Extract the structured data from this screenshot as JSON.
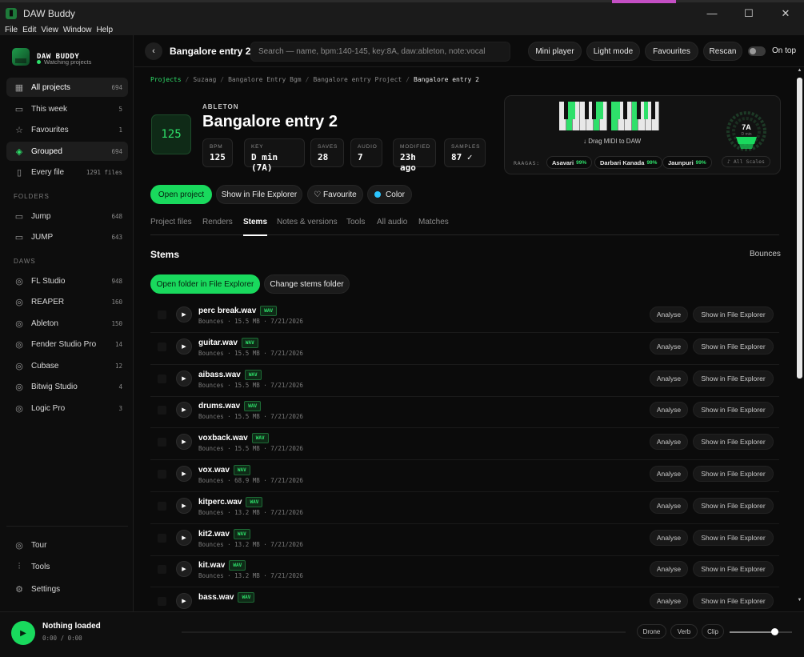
{
  "window": {
    "title": "DAW Buddy",
    "minimize": "—",
    "maximize": "☐",
    "close": "✕"
  },
  "menu": [
    "File",
    "Edit",
    "View",
    "Window",
    "Help"
  ],
  "brand": {
    "name": "DAW BUDDY",
    "status": "Watching projects"
  },
  "sidebar": {
    "nav": [
      {
        "label": "All projects",
        "count": "694",
        "icon": "grid-icon",
        "active": true
      },
      {
        "label": "This week",
        "count": "5",
        "icon": "calendar-icon",
        "active": false
      },
      {
        "label": "Favourites",
        "count": "1",
        "icon": "star-icon",
        "active": false
      },
      {
        "label": "Grouped",
        "count": "694",
        "icon": "layers-icon",
        "active": true
      },
      {
        "label": "Every file",
        "count": "1291 files",
        "icon": "file-icon",
        "active": false
      }
    ],
    "folders_label": "FOLDERS",
    "folders": [
      {
        "label": "Jump",
        "count": "648",
        "icon": "folder-icon"
      },
      {
        "label": "JUMP",
        "count": "643",
        "icon": "folder-icon"
      }
    ],
    "daws_label": "DAWS",
    "daws": [
      {
        "label": "FL Studio",
        "count": "948"
      },
      {
        "label": "REAPER",
        "count": "160"
      },
      {
        "label": "Ableton",
        "count": "150"
      },
      {
        "label": "Fender Studio Pro",
        "count": "14"
      },
      {
        "label": "Cubase",
        "count": "12"
      },
      {
        "label": "Bitwig Studio",
        "count": "4"
      },
      {
        "label": "Logic Pro",
        "count": "3"
      }
    ],
    "bottom": [
      {
        "label": "Tour",
        "icon": "compass-icon"
      },
      {
        "label": "Tools",
        "icon": "sliders-icon"
      },
      {
        "label": "Settings",
        "icon": "gear-icon"
      }
    ]
  },
  "topbar": {
    "back": "‹",
    "title": "Bangalore entry 2",
    "search_placeholder": "Search — name, bpm:140-145, key:8A, daw:ableton, note:vocal",
    "mini_player": "Mini player",
    "light_mode": "Light mode",
    "favourites": "Favourites",
    "rescan": "Rescan",
    "on_top": "On top"
  },
  "breadcrumb": [
    "Projects",
    "Suzaag",
    "Bangalore Entry Bgm",
    "Bangalore entry Project",
    "Bangalore entry 2"
  ],
  "project": {
    "bpm_tile": "125",
    "daw": "ABLETON",
    "title": "Bangalore entry 2",
    "stats": [
      {
        "k": "BPM",
        "v": "125"
      },
      {
        "k": "KEY",
        "v": "D min (7A)"
      },
      {
        "k": "SAVES",
        "v": "28"
      },
      {
        "k": "AUDIO",
        "v": "7"
      },
      {
        "k": "MODIFIED",
        "v": "23h ago"
      },
      {
        "k": "SAMPLES",
        "v": "87 ✓"
      }
    ]
  },
  "key_card": {
    "drag_midi": "↓ Drag MIDI to DAW",
    "raagas_label": "RAAGAS:",
    "raagas": [
      {
        "name": "Asavari",
        "pct": "99%"
      },
      {
        "name": "Darbari Kanada",
        "pct": "99%"
      },
      {
        "name": "Jaunpuri",
        "pct": "99%"
      }
    ],
    "all_scales": "♪ All Scales",
    "wheel_key": "7A",
    "wheel_sub": "D min",
    "accent": "#2ee06a"
  },
  "actions": {
    "open_project": "Open project",
    "show_explorer": "Show in File Explorer",
    "favourite": "♡ Favourite",
    "color": "Color",
    "color_value": "#2bc5ff"
  },
  "tabs": [
    "Project files",
    "Renders",
    "Stems",
    "Notes & versions",
    "Tools",
    "All audio",
    "Matches"
  ],
  "active_tab": "Stems",
  "stems": {
    "heading": "Stems",
    "bounces": "Bounces",
    "open_folder": "Open folder in File Explorer",
    "change_folder": "Change stems folder",
    "analyse": "Analyse",
    "show_explorer": "Show in File Explorer",
    "files": [
      {
        "name": "perc break.wav",
        "badge": "WAV",
        "meta": "Bounces · 15.5 MB · 7/21/2026"
      },
      {
        "name": "guitar.wav",
        "badge": "WAV",
        "meta": "Bounces · 15.5 MB · 7/21/2026"
      },
      {
        "name": "aibass.wav",
        "badge": "WAV",
        "meta": "Bounces · 15.5 MB · 7/21/2026"
      },
      {
        "name": "drums.wav",
        "badge": "WAV",
        "meta": "Bounces · 15.5 MB · 7/21/2026"
      },
      {
        "name": "voxback.wav",
        "badge": "WAV",
        "meta": "Bounces · 15.5 MB · 7/21/2026"
      },
      {
        "name": "vox.wav",
        "badge": "WAV",
        "meta": "Bounces · 68.9 MB · 7/21/2026"
      },
      {
        "name": "kitperc.wav",
        "badge": "WAV",
        "meta": "Bounces · 13.2 MB · 7/21/2026"
      },
      {
        "name": "kit2.wav",
        "badge": "WAV",
        "meta": "Bounces · 13.2 MB · 7/21/2026"
      },
      {
        "name": "kit.wav",
        "badge": "WAV",
        "meta": "Bounces · 13.2 MB · 7/21/2026"
      },
      {
        "name": "bass.wav",
        "badge": "WAV",
        "meta": ""
      }
    ]
  },
  "player": {
    "status": "Nothing loaded",
    "time": "0:00 / 0:00",
    "drone": "Drone",
    "verb": "Verb",
    "clip": "Clip",
    "volume": 0.72
  }
}
